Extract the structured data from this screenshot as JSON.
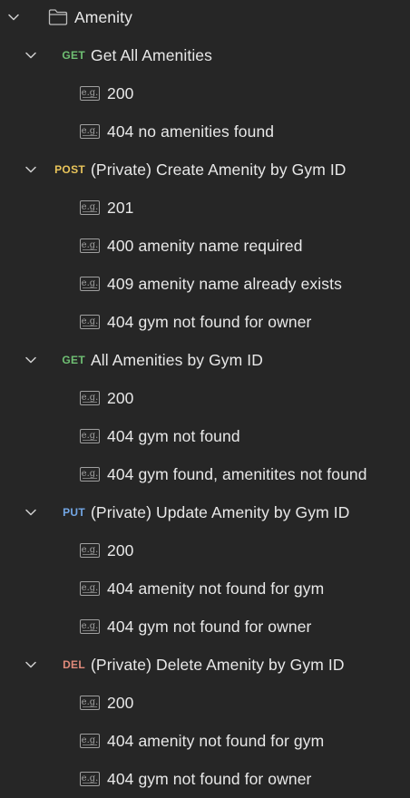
{
  "folder": {
    "label": "Amenity",
    "icon": "folder-icon"
  },
  "requests": [
    {
      "method": "GET",
      "label": "Get All Amenities",
      "examples": [
        "200",
        "404 no amenities found"
      ]
    },
    {
      "method": "POST",
      "label": "(Private) Create Amenity by Gym ID",
      "examples": [
        "201",
        "400 amenity name required",
        "409 amenity name already exists",
        "404 gym not found for owner"
      ]
    },
    {
      "method": "GET",
      "label": "All Amenities by Gym ID",
      "examples": [
        "200",
        "404 gym not found",
        "404 gym found, amenitites not found"
      ]
    },
    {
      "method": "PUT",
      "label": "(Private) Update Amenity by Gym ID",
      "examples": [
        "200",
        "404 amenity not found for gym",
        "404 gym not found for owner"
      ]
    },
    {
      "method": "DEL",
      "label": "(Private) Delete Amenity by Gym ID",
      "examples": [
        "200",
        "404 amenity not found for gym",
        "404 gym not found for owner"
      ]
    }
  ],
  "example_icon_text": "e.g.",
  "colors": {
    "background": "#262626",
    "text": "#e8e8e8",
    "get": "#6fbf73",
    "post": "#e8c45a",
    "put": "#73a7e6",
    "del": "#e08a7a"
  }
}
